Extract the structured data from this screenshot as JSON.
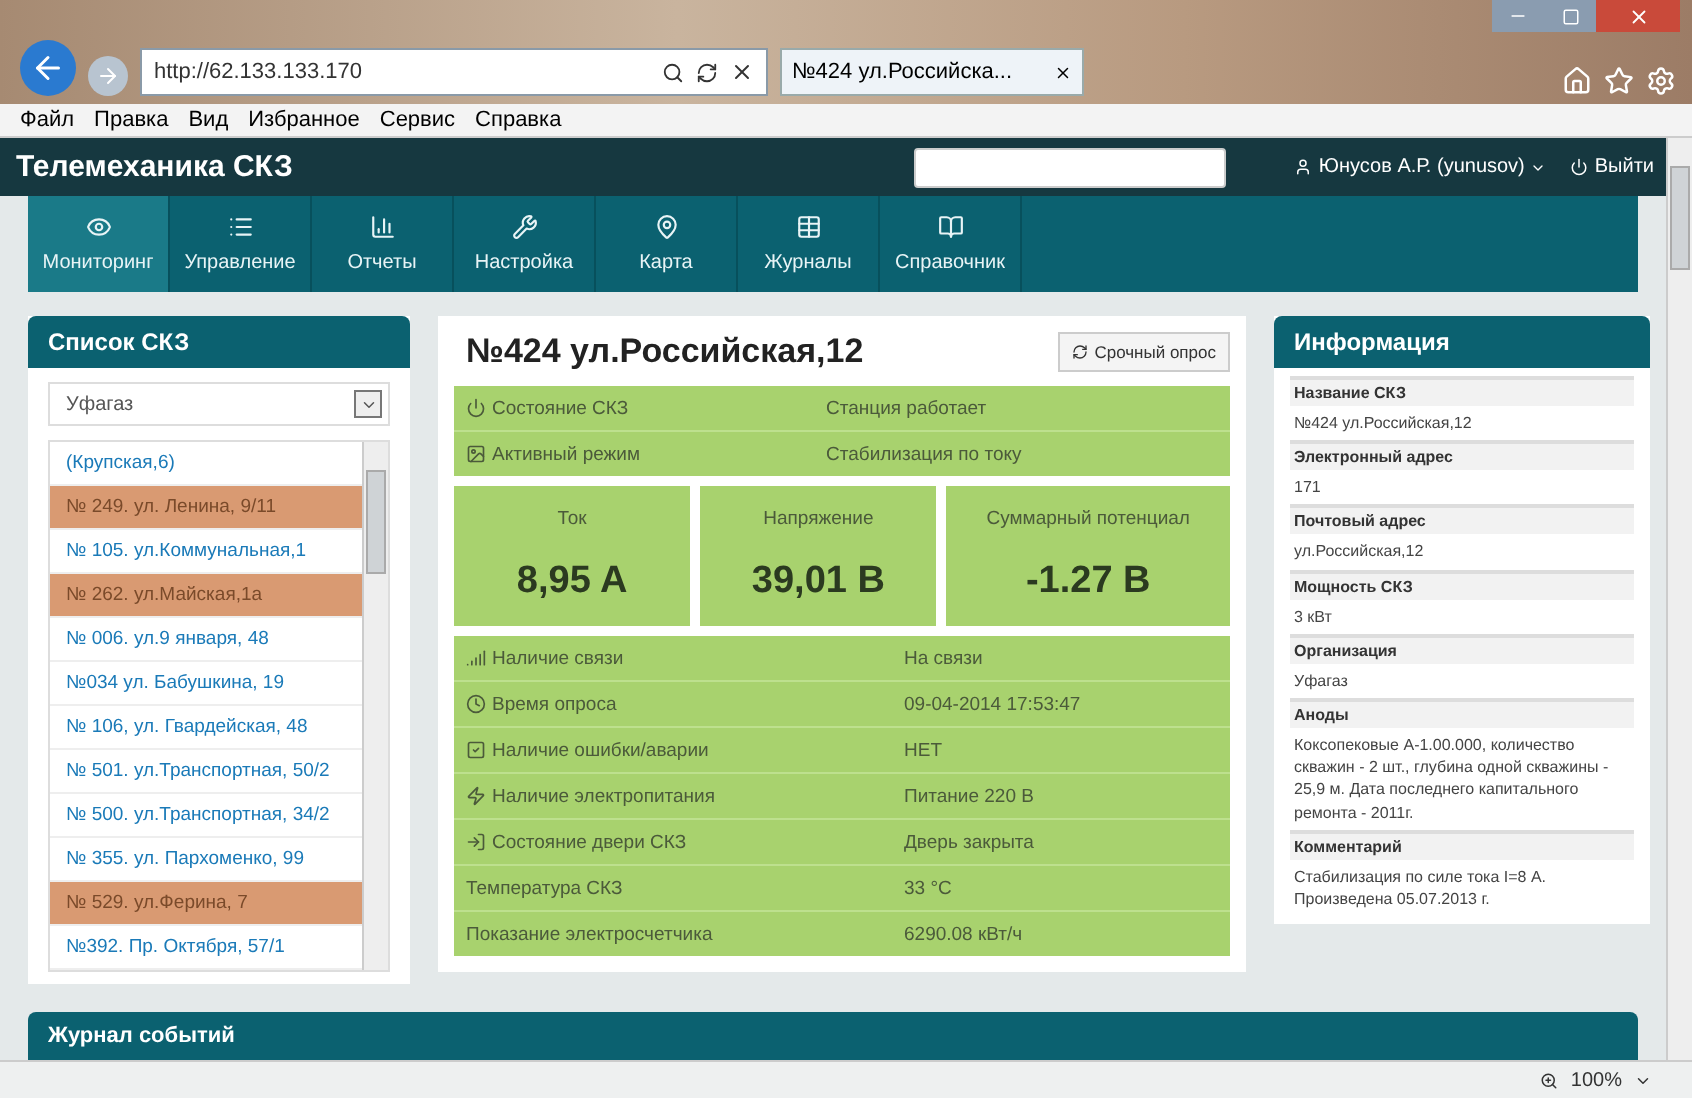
{
  "browser": {
    "address": "http://62.133.133.170",
    "tab_title": "№424 ул.Российска...",
    "menu": [
      "Файл",
      "Правка",
      "Вид",
      "Избранное",
      "Сервис",
      "Справка"
    ],
    "zoom": "100%"
  },
  "header": {
    "title": "Телемеханика СКЗ",
    "user": "Юнусов А.Р. (yunusov)",
    "logout": "Выйти"
  },
  "nav": [
    {
      "label": "Мониторинг",
      "selected": true
    },
    {
      "label": "Управление",
      "selected": false
    },
    {
      "label": "Отчеты",
      "selected": false
    },
    {
      "label": "Настройка",
      "selected": false
    },
    {
      "label": "Карта",
      "selected": false
    },
    {
      "label": "Журналы",
      "selected": false
    },
    {
      "label": "Справочник",
      "selected": false
    }
  ],
  "station_list": {
    "title": "Список СКЗ",
    "filter": "Уфагаз",
    "items": [
      {
        "label": "(Крупская,6)",
        "alarm": false
      },
      {
        "label": "№ 249. ул. Ленина, 9/11",
        "alarm": true
      },
      {
        "label": "№ 105. ул.Коммунальная,1",
        "alarm": false
      },
      {
        "label": "№ 262. ул.Майская,1а",
        "alarm": true
      },
      {
        "label": "№ 006. ул.9 января, 48",
        "alarm": false
      },
      {
        "label": "№034 ул. Бабушкина, 19",
        "alarm": false
      },
      {
        "label": "№ 106, ул. Гвардейская, 48",
        "alarm": false
      },
      {
        "label": "№ 501. ул.Транспортная, 50/2",
        "alarm": false
      },
      {
        "label": "№ 500. ул.Транспортная, 34/2",
        "alarm": false
      },
      {
        "label": "№ 355. ул. Пархоменко, 99",
        "alarm": false
      },
      {
        "label": "№ 529. ул.Ферина, 7",
        "alarm": true
      },
      {
        "label": "№392. Пр. Октября, 57/1",
        "alarm": false
      }
    ]
  },
  "station": {
    "title": "№424 ул.Российская,12",
    "poll_button": "Срочный опрос",
    "status_rows": [
      {
        "label": "Состояние СКЗ",
        "value": "Станция работает"
      },
      {
        "label": "Активный режим",
        "value": "Стабилизация по току"
      }
    ],
    "metrics": [
      {
        "label": "Ток",
        "value": "8,95 A"
      },
      {
        "label": "Напряжение",
        "value": "39,01 В"
      },
      {
        "label": "Суммарный потенциал",
        "value": "-1.27 В"
      }
    ],
    "detail_rows": [
      {
        "label": "Наличие связи",
        "value": "На связи"
      },
      {
        "label": "Время опроса",
        "value": "09-04-2014 17:53:47"
      },
      {
        "label": "Наличие ошибки/аварии",
        "value": "НЕТ"
      },
      {
        "label": "Наличие электропитания",
        "value": "Питание 220 В"
      },
      {
        "label": "Состояние двери СКЗ",
        "value": "Дверь закрыта"
      },
      {
        "label": "Температура СКЗ",
        "value": "33 °C"
      },
      {
        "label": "Показание электросчетчика",
        "value": "6290.08 кВт/ч"
      }
    ]
  },
  "info": {
    "title": "Информация",
    "fields": [
      {
        "label": "Название СКЗ",
        "value": "№424 ул.Российская,12"
      },
      {
        "label": "Электронный адрес",
        "value": "171"
      },
      {
        "label": "Почтовый адрес",
        "value": "ул.Российская,12"
      },
      {
        "label": "Мощность СКЗ",
        "value": "3 кВт"
      },
      {
        "label": "Организация",
        "value": "Уфагаз"
      },
      {
        "label": "Аноды",
        "value": "Коксопековые А-1.00.000, количество скважин - 2 шт., глубина одной скважины - 25,9 м. Дата последнего капитального ремонта - 2011г."
      },
      {
        "label": "Комментарий",
        "value": "Стабилизация по силе тока I=8 А. Произведена 05.07.2013 г."
      }
    ]
  },
  "event_log": {
    "title": "Журнал событий"
  }
}
